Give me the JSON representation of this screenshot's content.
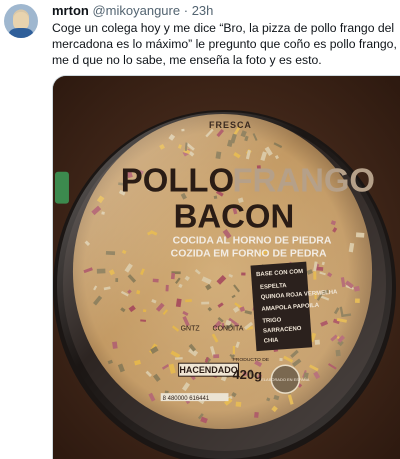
{
  "tweet": {
    "author_name": "mrton",
    "handle": "@mikoyangure",
    "separator": "·",
    "time": "23h",
    "text": "Coge un colega hoy y me dice “Bro, la pizza de pollo frango del mercadona es lo máximo” le pregunto que coño es pollo frango, me d que no lo sabe, me enseña la foto y es esto."
  },
  "pizza_label": {
    "brand_arc": "FRESCA",
    "line1_a": "POLLO",
    "line1_b": "FRANGO",
    "line2": "BACON",
    "sub1": "COCIDA AL HORNO DE PIEDRA",
    "sub2": "COZIDA EM FORNO DE PEDRA",
    "base_title": "BASE CON COM",
    "base_items": [
      "ESPELTA",
      "QUINOA ROJA VERMELHA",
      "AMAPOLA PAPOILA",
      "TRIGO",
      "SARRACENO",
      "CHIA"
    ],
    "brand": "HACENDADO",
    "weight": "420g",
    "product_of": "PRODUCTO DE",
    "pouch_code": "GNTZ",
    "pouch_code2": "CONDITA",
    "origin_badge": "ELABORADO EN ESPAÑA",
    "barcode": "8 480000 616441"
  },
  "colors": {
    "label_text": "#2a1c15",
    "frango_accent": "#b5a089",
    "wood": "#3a2418",
    "crust": "#c9a371",
    "cheese": "#e3b54a",
    "bacon": "#b2656f"
  }
}
